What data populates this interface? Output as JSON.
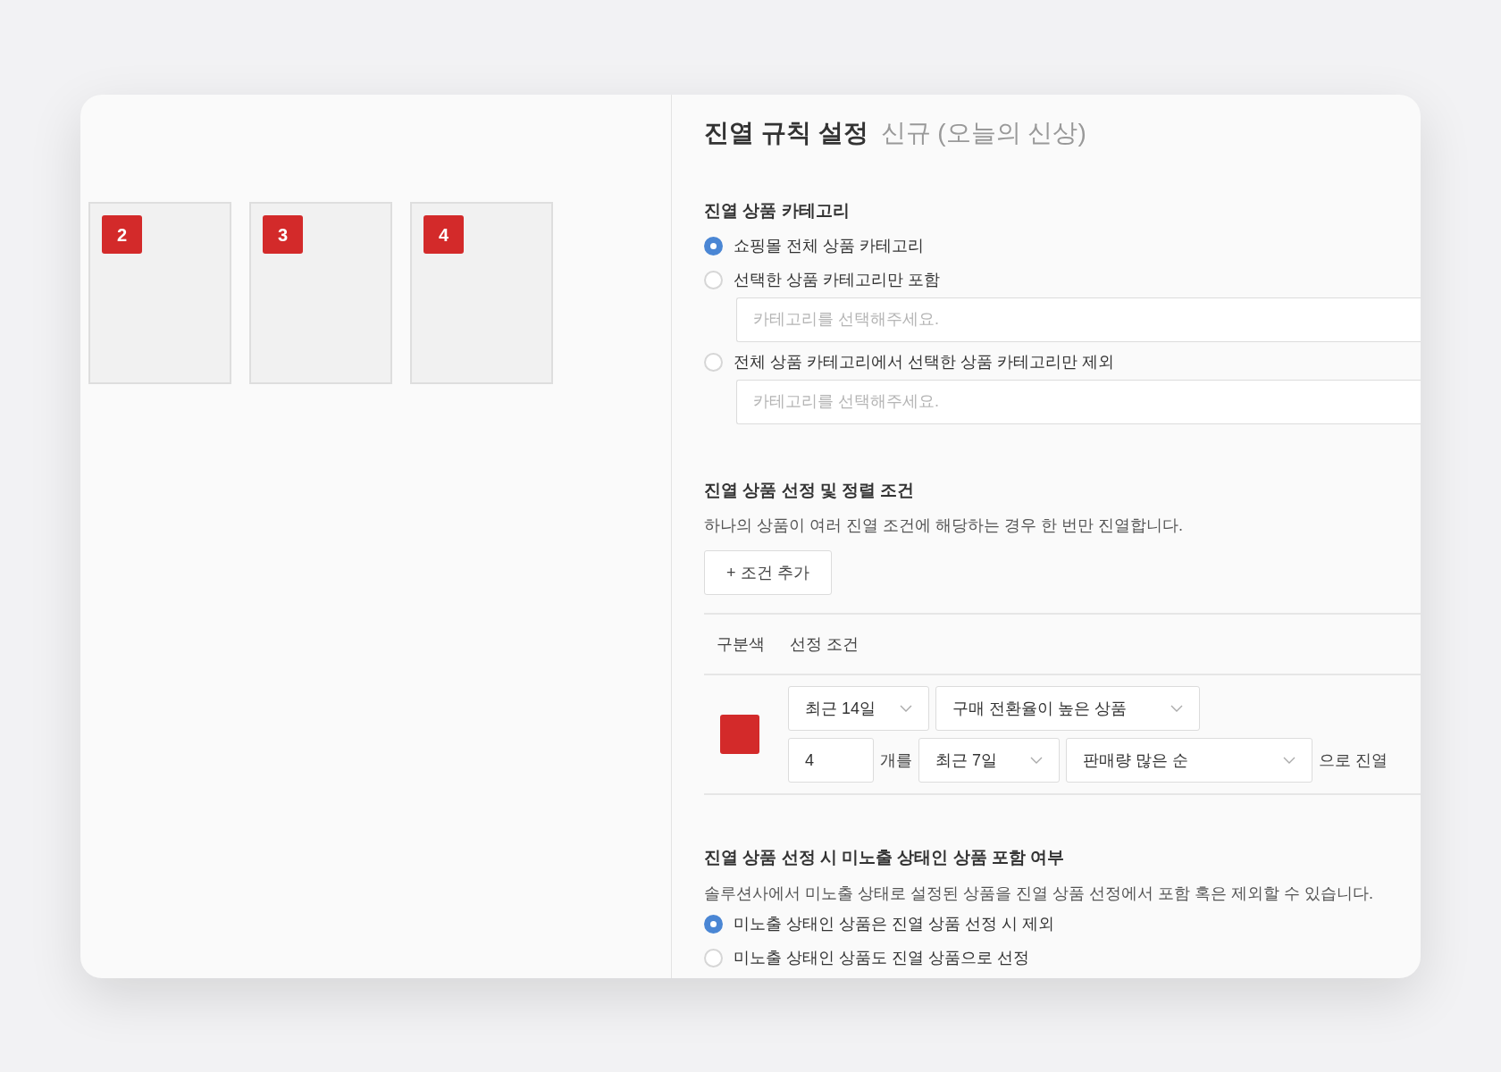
{
  "preview": {
    "tiles": [
      {
        "badge": "2",
        "color": "#d32a2a"
      },
      {
        "badge": "3",
        "color": "#d32a2a"
      },
      {
        "badge": "4",
        "color": "#d32a2a"
      }
    ]
  },
  "settings": {
    "title": "진열 규칙 설정",
    "subtitle": "신규 (오늘의 신상)",
    "category": {
      "heading": "진열 상품 카테고리",
      "options": [
        {
          "label": "쇼핑몰 전체 상품 카테고리",
          "selected": true
        },
        {
          "label": "선택한 상품 카테고리만 포함",
          "selected": false,
          "placeholder": "카테고리를 선택해주세요."
        },
        {
          "label": "전체 상품 카테고리에서 선택한 상품 카테고리만 제외",
          "selected": false,
          "placeholder": "카테고리를 선택해주세요."
        }
      ]
    },
    "conditions": {
      "heading": "진열 상품 선정 및 정렬 조건",
      "description": "하나의 상품이 여러 진열 조건에 해당하는 경우 한 번만 진열합니다.",
      "add_button": "+ 조건 추가",
      "columns": [
        "구분색",
        "선정 조건"
      ],
      "rows": [
        {
          "color": "#d32a2a",
          "period": "최근 14일",
          "criterion": "구매 전환율이 높은 상품",
          "count": "4",
          "count_suffix": "개를",
          "sort_period": "최근 7일",
          "sort": "판매량 많은 순",
          "suffix": "으로 진열"
        }
      ]
    },
    "hidden": {
      "heading": "진열 상품 선정 시 미노출 상태인 상품 포함 여부",
      "description": "솔루션사에서 미노출 상태로 설정된 상품을 진열 상품 선정에서 포함 혹은 제외할 수 있습니다.",
      "options": [
        {
          "label": "미노출 상태인 상품은 진열 상품 선정 시 제외",
          "selected": true
        },
        {
          "label": "미노출 상태인 상품도 진열 상품으로 선정",
          "selected": false
        }
      ]
    }
  }
}
